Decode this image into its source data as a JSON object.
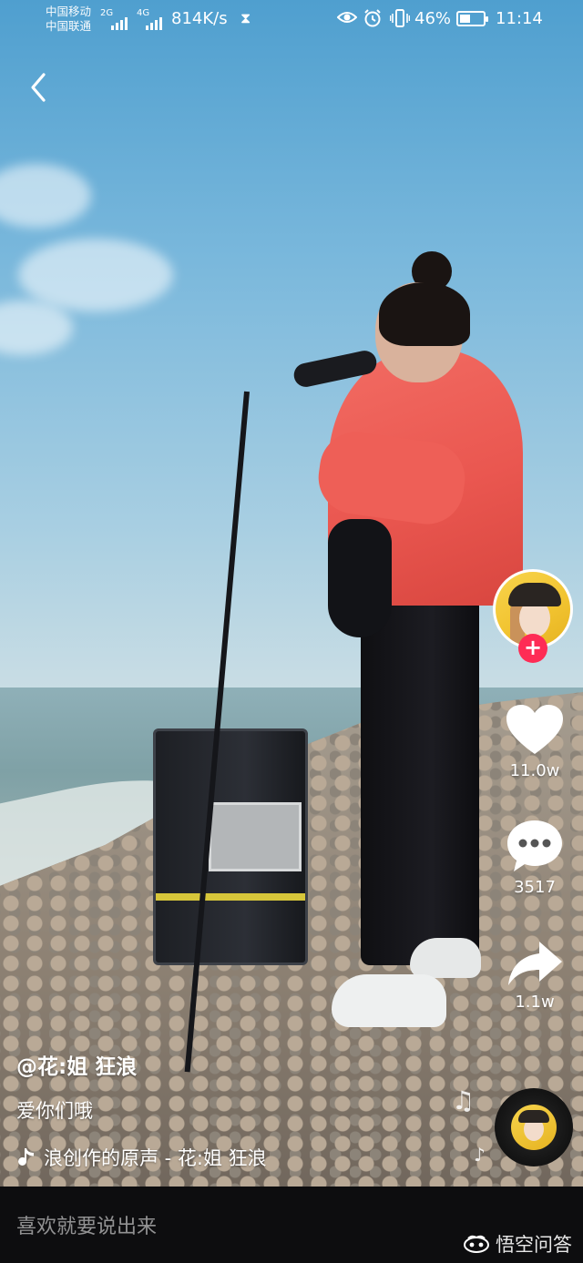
{
  "status_bar": {
    "carrier_1": "中国移动",
    "carrier_2": "中国联通",
    "net_1": "2G",
    "net_2": "4G",
    "speed": "814K/s",
    "battery_percent": "46%",
    "battery_level": 0.46,
    "time": "11:14"
  },
  "video": {
    "author": "@花:姐 狂浪",
    "caption": "爱你们哦",
    "music": "浪创作的原声 - 花:姐 狂浪"
  },
  "actions": {
    "likes": "11.0w",
    "comments": "3517",
    "shares": "1.1w"
  },
  "comment_bar": {
    "placeholder": "喜欢就要说出来"
  },
  "watermark": {
    "text": "悟空问答"
  },
  "icons": {
    "back": "back-arrow-icon",
    "like": "heart-icon",
    "comment": "comment-bubble-icon",
    "share": "share-arrow-icon",
    "follow": "plus-icon",
    "music": "music-note-icon"
  },
  "colors": {
    "follow_accent": "#fe2c55",
    "comment_bar_bg": "#0d0d0f"
  }
}
